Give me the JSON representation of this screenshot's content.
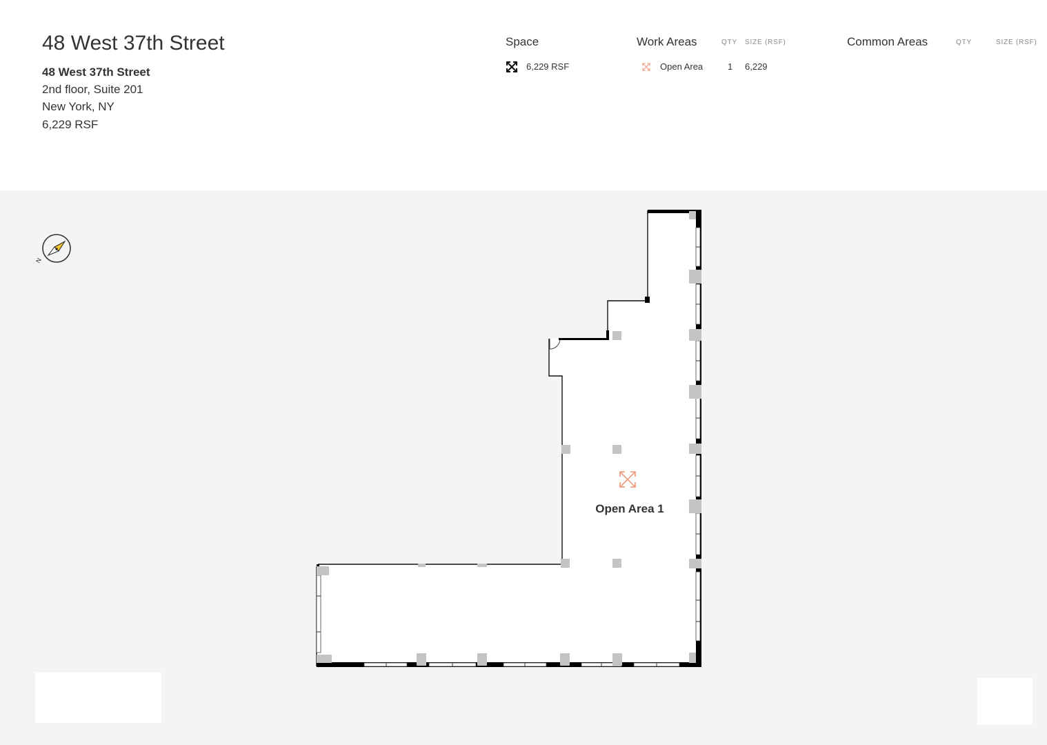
{
  "listing": {
    "title": "48 West 37th Street",
    "address_line1": "48 West 37th Street",
    "address_line2": "2nd floor, Suite 201",
    "address_line3": "New York, NY",
    "size": "6,229 RSF"
  },
  "space": {
    "heading": "Space",
    "icon": "expand-arrows-icon",
    "value": "6,229 RSF"
  },
  "work_areas": {
    "heading": "Work Areas",
    "qty_header": "QTY",
    "size_header": "SIZE (RSF)",
    "rows": [
      {
        "icon": "expand-arrows-icon",
        "name": "Open Area",
        "qty": "1",
        "size": "6,229"
      }
    ]
  },
  "common_areas": {
    "heading": "Common Areas",
    "qty_header": "QTY",
    "size_header": "SIZE (RSF)"
  },
  "floorplan": {
    "room_label": "Open Area 1",
    "compass_letter": "N",
    "colors": {
      "open_area_accent": "#f0a285",
      "compass_needle": "#f2c230",
      "wall": "#000000",
      "column": "#c4c4c4",
      "background": "#f4f4f4"
    }
  }
}
